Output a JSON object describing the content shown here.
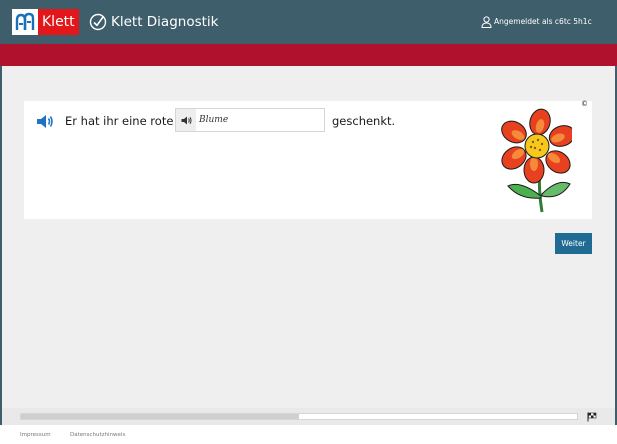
{
  "header": {
    "logo_text": "Klett",
    "app_title": "Klett Diagnostik",
    "user_status": "Angemeldet als c6tc 5h1c"
  },
  "task": {
    "sentence_before": "Er hat ihr eine rote",
    "answer_value": "Blume",
    "sentence_after": "geschenkt.",
    "copyright": "©"
  },
  "actions": {
    "next_label": "Weiter"
  },
  "progress": {
    "fraction": 0.5
  },
  "footer": {
    "imprint": "Impressum",
    "privacy": "Datenschutzhinweis"
  },
  "icons": {
    "logo": "klett-logo-icon",
    "check": "check-circle-icon",
    "user": "user-icon",
    "speaker": "speaker-icon",
    "flag": "finish-flag-icon"
  },
  "colors": {
    "header": "#3e5e6c",
    "accent_red": "#b0112d",
    "button": "#1f6b93"
  }
}
